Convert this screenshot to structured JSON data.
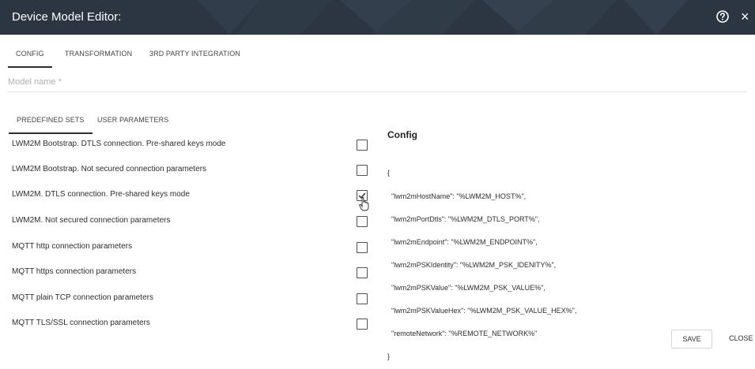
{
  "titlebar": {
    "title": "Device Model Editor:",
    "help_icon": "question-circle-icon",
    "close_icon": "close-icon",
    "close_glyph": "×"
  },
  "top_tabs": [
    {
      "label": "CONFIG",
      "active": true
    },
    {
      "label": "TRANSFORMATION",
      "active": false
    },
    {
      "label": "3RD PARTY INTEGRATION",
      "active": false
    }
  ],
  "model_name": {
    "placeholder": "Model name *",
    "value": ""
  },
  "sub_tabs": [
    {
      "label": "PREDEFINED SETS",
      "active": true
    },
    {
      "label": "USER PARAMETERS",
      "active": false
    }
  ],
  "predefined_sets": [
    {
      "label": "LWM2M Bootstrap. DTLS connection. Pre-shared keys mode",
      "checked": false
    },
    {
      "label": "LWM2M Bootstrap. Not secured connection parameters",
      "checked": false
    },
    {
      "label": "LWM2M. DTLS connection. Pre-shared keys mode",
      "checked": true
    },
    {
      "label": "LWM2M. Not secured connection parameters",
      "checked": false
    },
    {
      "label": "MQTT http connection parameters",
      "checked": false
    },
    {
      "label": "MQTT https connection parameters",
      "checked": false
    },
    {
      "label": "MQTT plain TCP connection parameters",
      "checked": false
    },
    {
      "label": "MQTT TLS/SSL connection parameters",
      "checked": false
    }
  ],
  "config": {
    "title": "Config",
    "lines": [
      "{",
      "  \"lwm2mHostName\": \"%LWM2M_HOST%\",",
      "  \"lwm2mPortDtls\": \"%LWM2M_DTLS_PORT%\",",
      "  \"lwm2mEndpoint\": \"%LWM2M_ENDPOINT%\",",
      "  \"lwm2mPSKIdentity\": \"%LWM2M_PSK_IDENITY%\",",
      "  \"lwm2mPSKValue\": \"%LWM2M_PSK_VALUE%\",",
      "  \"lwm2mPSKValueHex\": \"%LWM2M_PSK_VALUE_HEX%\",",
      "  \"remoteNetwork\": \"%REMOTE_NETWORK%\"",
      "}"
    ]
  },
  "actions": {
    "save_label": "SAVE",
    "close_label": "CLOSE"
  },
  "colors": {
    "titlebar": "#2c3643",
    "accent": "#2d2d2d"
  }
}
